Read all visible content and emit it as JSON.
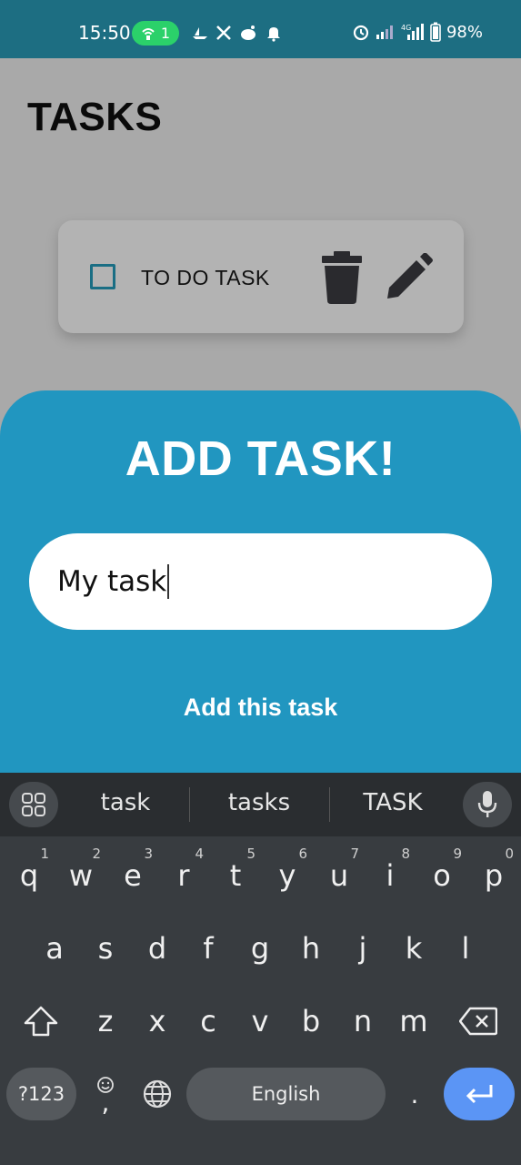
{
  "status_bar": {
    "time": "15:50",
    "hotspot_count": "1",
    "battery": "98%",
    "network_label": "4G"
  },
  "app": {
    "title": "TASKS",
    "tasks": [
      {
        "label": "TO DO TASK",
        "checked": false
      }
    ]
  },
  "sheet": {
    "title": "ADD TASK!",
    "input_value": "My task",
    "add_label": "Add this task"
  },
  "keyboard": {
    "suggestions": [
      "task",
      "tasks",
      "TASK"
    ],
    "row1": [
      {
        "k": "q",
        "n": "1"
      },
      {
        "k": "w",
        "n": "2"
      },
      {
        "k": "e",
        "n": "3"
      },
      {
        "k": "r",
        "n": "4"
      },
      {
        "k": "t",
        "n": "5"
      },
      {
        "k": "y",
        "n": "6"
      },
      {
        "k": "u",
        "n": "7"
      },
      {
        "k": "i",
        "n": "8"
      },
      {
        "k": "o",
        "n": "9"
      },
      {
        "k": "p",
        "n": "0"
      }
    ],
    "row2": [
      "a",
      "s",
      "d",
      "f",
      "g",
      "h",
      "j",
      "k",
      "l"
    ],
    "row3": [
      "z",
      "x",
      "c",
      "v",
      "b",
      "n",
      "m"
    ],
    "symbols_label": "?123",
    "comma_label": ",",
    "space_label": "English",
    "period_label": "."
  },
  "colors": {
    "status_bar": "#1d6e82",
    "sheet": "#2196c0",
    "enter_key": "#5b95f5"
  }
}
